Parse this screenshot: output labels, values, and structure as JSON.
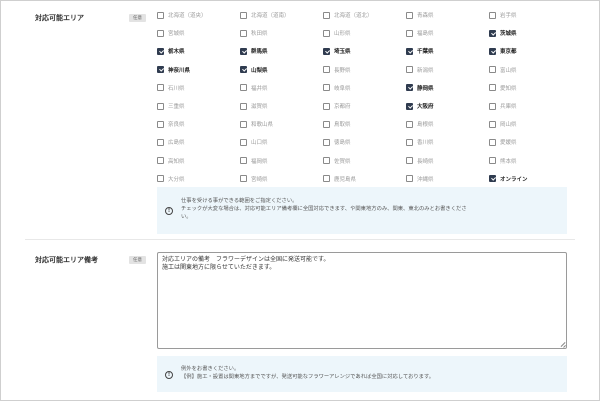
{
  "area": {
    "label": "対応可能エリア",
    "badge": "任意",
    "options": [
      {
        "label": "北海道（道央）",
        "checked": false
      },
      {
        "label": "北海道（道南）",
        "checked": false
      },
      {
        "label": "北海道（道北）",
        "checked": false
      },
      {
        "label": "青森県",
        "checked": false
      },
      {
        "label": "岩手県",
        "checked": false
      },
      {
        "label": "宮城県",
        "checked": false
      },
      {
        "label": "秋田県",
        "checked": false
      },
      {
        "label": "山形県",
        "checked": false
      },
      {
        "label": "福島県",
        "checked": false
      },
      {
        "label": "茨城県",
        "checked": true
      },
      {
        "label": "栃木県",
        "checked": true
      },
      {
        "label": "群馬県",
        "checked": true
      },
      {
        "label": "埼玉県",
        "checked": true
      },
      {
        "label": "千葉県",
        "checked": true
      },
      {
        "label": "東京都",
        "checked": true
      },
      {
        "label": "神奈川県",
        "checked": true
      },
      {
        "label": "山梨県",
        "checked": true
      },
      {
        "label": "長野県",
        "checked": false
      },
      {
        "label": "新潟県",
        "checked": false
      },
      {
        "label": "富山県",
        "checked": false
      },
      {
        "label": "石川県",
        "checked": false
      },
      {
        "label": "福井県",
        "checked": false
      },
      {
        "label": "岐阜県",
        "checked": false
      },
      {
        "label": "静岡県",
        "checked": true
      },
      {
        "label": "愛知県",
        "checked": false
      },
      {
        "label": "三重県",
        "checked": false
      },
      {
        "label": "滋賀県",
        "checked": false
      },
      {
        "label": "京都府",
        "checked": false
      },
      {
        "label": "大阪府",
        "checked": true
      },
      {
        "label": "兵庫県",
        "checked": false
      },
      {
        "label": "奈良県",
        "checked": false
      },
      {
        "label": "和歌山県",
        "checked": false
      },
      {
        "label": "鳥取県",
        "checked": false
      },
      {
        "label": "島根県",
        "checked": false
      },
      {
        "label": "岡山県",
        "checked": false
      },
      {
        "label": "広島県",
        "checked": false
      },
      {
        "label": "山口県",
        "checked": false
      },
      {
        "label": "徳島県",
        "checked": false
      },
      {
        "label": "香川県",
        "checked": false
      },
      {
        "label": "愛媛県",
        "checked": false
      },
      {
        "label": "高知県",
        "checked": false
      },
      {
        "label": "福岡県",
        "checked": false
      },
      {
        "label": "佐賀県",
        "checked": false
      },
      {
        "label": "長崎県",
        "checked": false
      },
      {
        "label": "熊本県",
        "checked": false
      },
      {
        "label": "大分県",
        "checked": false
      },
      {
        "label": "宮崎県",
        "checked": false
      },
      {
        "label": "鹿児島県",
        "checked": false
      },
      {
        "label": "沖縄県",
        "checked": false
      },
      {
        "label": "オンライン",
        "checked": true
      }
    ],
    "info_icon": "info-icon",
    "info_lines": [
      "仕事を受ける事ができる範囲をご指定ください。",
      "チェックが大変な場合は、対応可能エリア備考欄に全国対応できます、や関東地方のみ、関東、東北のみとお書きくださ",
      "い。"
    ]
  },
  "remarks": {
    "label": "対応可能エリア備考",
    "badge": "任意",
    "value_lines": [
      "対応エリアの備考　フラワーデザインは全国に発送可能です。",
      "施工は関東地方に限らせていただきます。"
    ],
    "info_icon": "info-icon",
    "info_lines": [
      "例外をお書きください。",
      "【例】施工・設置は関東地方までですが、発送可能なフラワーアレンジであれば全国に対応しております。"
    ]
  },
  "colors": {
    "checked_box": "#2f3b4f",
    "info_bg": "#edf6fb",
    "badge_bg": "#e3e3e3"
  }
}
